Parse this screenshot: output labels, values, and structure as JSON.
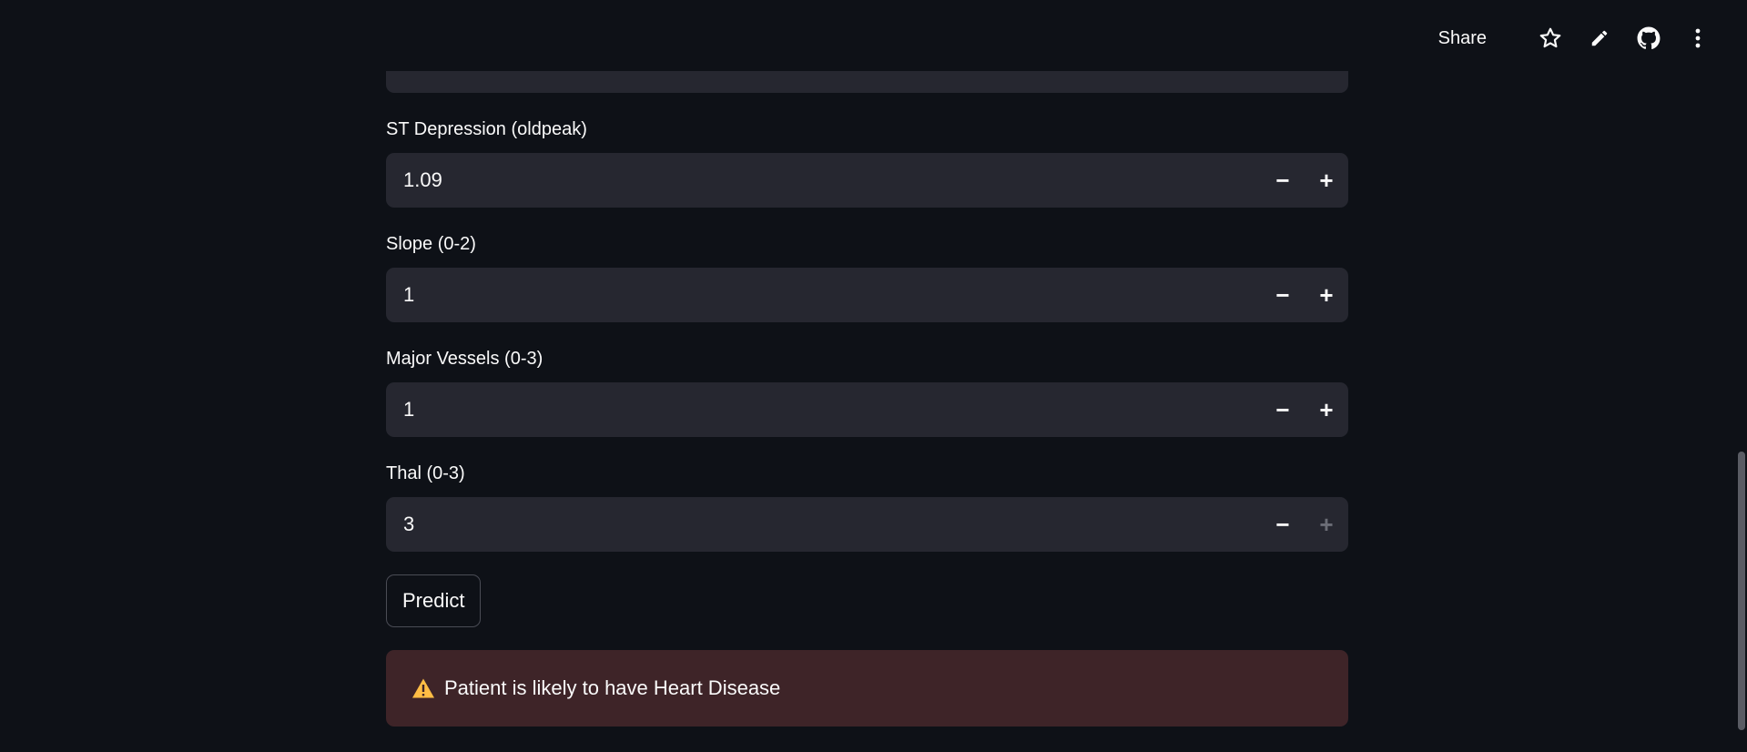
{
  "toolbar": {
    "share_label": "Share",
    "icons": [
      "star-icon",
      "pencil-icon",
      "github-icon",
      "more-vertical-icon"
    ]
  },
  "fields": [
    {
      "label": "ST Depression (oldpeak)",
      "value": "1.09",
      "minus_enabled": true,
      "plus_enabled": true
    },
    {
      "label": "Slope (0-2)",
      "value": "1",
      "minus_enabled": true,
      "plus_enabled": true
    },
    {
      "label": "Major Vessels (0-3)",
      "value": "1",
      "minus_enabled": true,
      "plus_enabled": true
    },
    {
      "label": "Thal (0-3)",
      "value": "3",
      "minus_enabled": true,
      "plus_enabled": false
    }
  ],
  "stepper": {
    "minus_glyph": "−",
    "plus_glyph": "+"
  },
  "predict_button": {
    "label": "Predict"
  },
  "result_alert": {
    "icon": "warning-icon",
    "text": "Patient is likely to have Heart Disease",
    "background": "#3e2428"
  },
  "colors": {
    "background": "#0e1117",
    "input_background": "#262730",
    "text": "#fafafa",
    "warning_icon": "#ffbd45"
  }
}
